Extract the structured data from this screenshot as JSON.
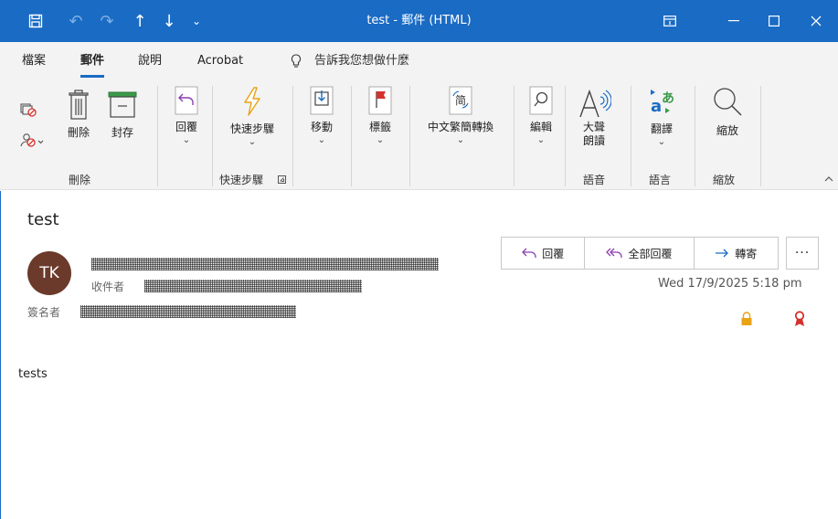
{
  "window": {
    "title": "test - 郵件 (HTML)",
    "quick_access": [
      "save-icon",
      "undo-icon",
      "redo-icon",
      "up-arrow-icon",
      "down-arrow-icon",
      "customize-icon"
    ],
    "controls": [
      "ribbon-display-icon",
      "minimize-icon",
      "maximize-icon",
      "close-icon"
    ]
  },
  "menu": {
    "tabs": [
      "檔案",
      "郵件",
      "說明",
      "Acrobat"
    ],
    "active_tab": "郵件",
    "tell_me": "告訴我您想做什麼"
  },
  "ribbon": {
    "delete_group": {
      "delete_label": "刪除",
      "archive_label": "封存",
      "group_label": "刪除"
    },
    "reply_label": "回覆",
    "quick_steps": {
      "label": "快速步驟",
      "group_label": "快速步驟"
    },
    "move_label": "移動",
    "tags_label": "標籤",
    "chinese_conversion_label": "中文繁簡轉換",
    "editing_label": "編輯",
    "read_aloud": {
      "line1": "大聲",
      "line2": "朗讀",
      "group_label": "語音"
    },
    "translate": {
      "label": "翻譯",
      "group_label": "語言"
    },
    "zoom": {
      "label": "縮放",
      "group_label": "縮放"
    }
  },
  "message": {
    "subject": "test",
    "avatar_initials": "TK",
    "to_label": "收件者",
    "signed_by_label": "簽名者",
    "actions": {
      "reply": "回覆",
      "reply_all": "全部回覆",
      "forward": "轉寄",
      "more": "···"
    },
    "date": "Wed 17/9/2025 5:18 pm",
    "body": "tests"
  },
  "colors": {
    "accent": "#1a6bc4",
    "avatar_bg": "#6b3a2a",
    "lock": "#e8a317",
    "badge": "#d4322c"
  }
}
